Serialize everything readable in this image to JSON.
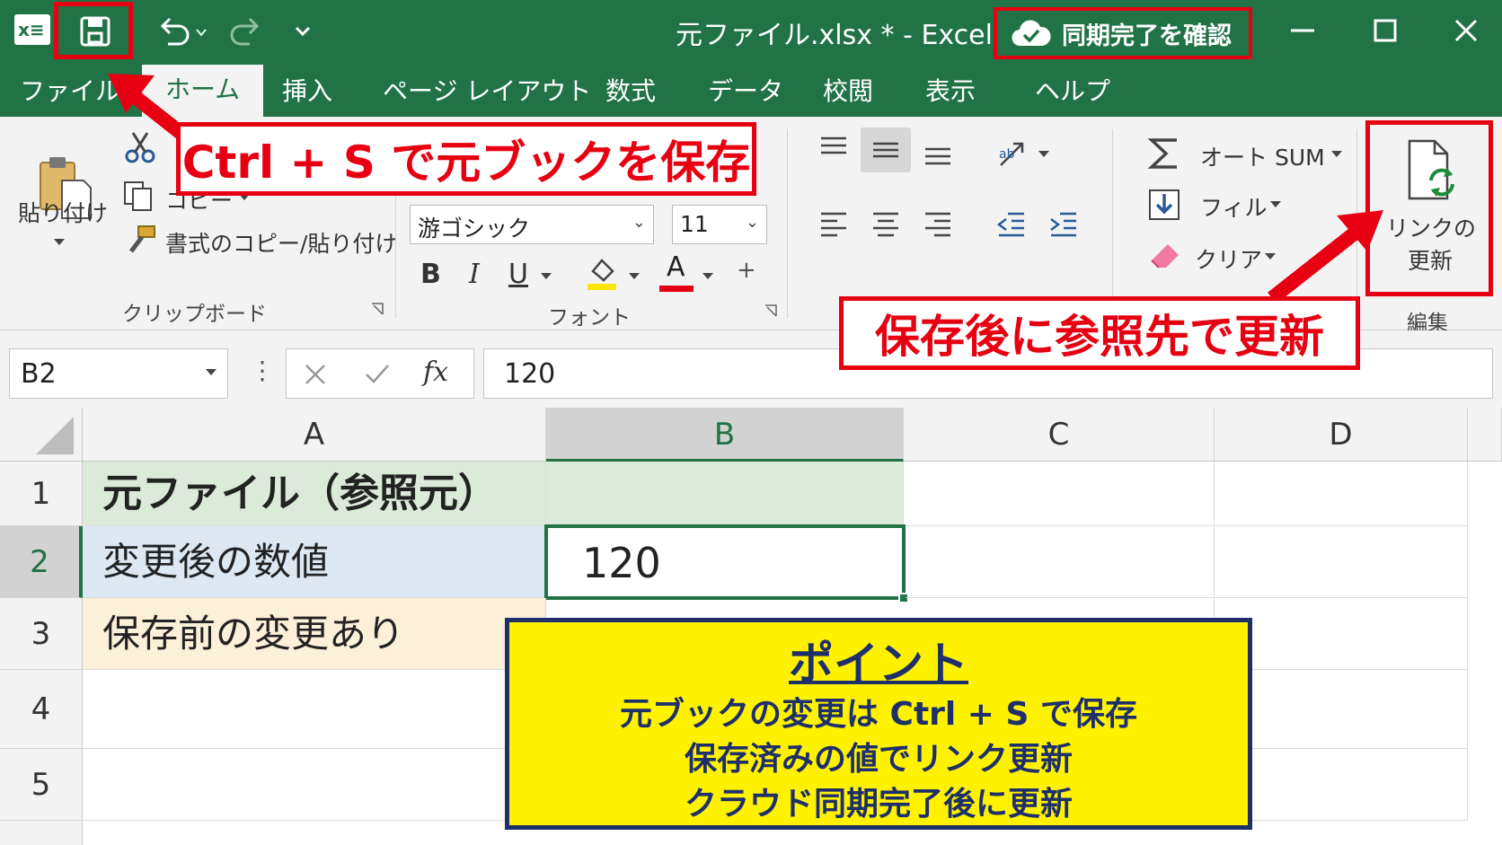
{
  "window": {
    "title": "元ファイル.xlsx * - Excel",
    "sync_button": "同期完了を確認"
  },
  "tabs": [
    "ファイル",
    "ホーム",
    "挿入",
    "ページ レイアウト",
    "数式",
    "データ",
    "校閲",
    "表示",
    "ヘルプ"
  ],
  "ribbon": {
    "clipboard": {
      "paste": "貼り付け",
      "copy": "コピー",
      "format_painter": "書式のコピー/貼り付け",
      "label": "クリップボード"
    },
    "font": {
      "name": "游ゴシック",
      "size": "11",
      "bold": "B",
      "italic": "I",
      "underline": "U",
      "font_color": "A",
      "label": "フォント"
    },
    "editing": {
      "autosum": "オート SUM",
      "fill": "フィル",
      "clear": "クリア",
      "refresh_links_line1": "リンクの",
      "refresh_links_line2": "更新",
      "label": "編集"
    }
  },
  "formula_bar": {
    "name_box": "B2",
    "fx": "fx",
    "value": "120"
  },
  "grid": {
    "columns": [
      "A",
      "B",
      "C",
      "D"
    ],
    "rows": [
      "1",
      "2",
      "3",
      "4",
      "5"
    ],
    "cells": {
      "A1": "元ファイル（参照元）",
      "A2": "変更後の数値",
      "A3": "保存前の変更あり",
      "B2": "120"
    }
  },
  "callouts": {
    "save_tip": "Ctrl + S で元ブックを保存",
    "refresh_tip": "保存後に参照先で更新",
    "point_title": "ポイント",
    "point_lines": [
      "元ブックの変更は Ctrl + S で保存",
      "保存済みの値でリンク更新",
      "クラウド同期完了後に更新"
    ]
  },
  "colors": {
    "excel_green": "#217346",
    "callout_red": "#e60012",
    "point_yellow": "#fff200",
    "point_navy": "#1e2f6b"
  }
}
